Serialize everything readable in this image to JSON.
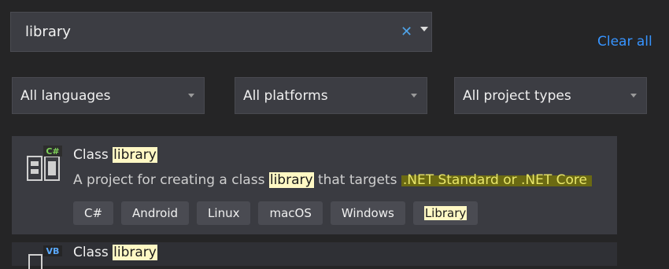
{
  "search": {
    "value": "library"
  },
  "clear_all": "Clear all",
  "filters": {
    "languages": "All languages",
    "platforms": "All platforms",
    "project_types": "All project types"
  },
  "templates": [
    {
      "title_prefix": "Class ",
      "title_highlight": "library",
      "description_prefix": "A project for creating a class ",
      "description_highlight": "library",
      "description_middle": " that targets ",
      "description_emphasis": ".NET Standard or .NET Core",
      "language_badge": "C#",
      "tags": [
        "C#",
        "Android",
        "Linux",
        "macOS",
        "Windows"
      ],
      "highlighted_tag": "Library"
    },
    {
      "title_prefix": "Class ",
      "title_highlight": "library",
      "language_badge": "VB"
    }
  ],
  "colors": {
    "background": "#252526",
    "accent": "#3794ff",
    "highlight": "#fff8c4"
  },
  "icons": [
    "clear-icon",
    "dropdown-caret-icon",
    "class-library-icon"
  ]
}
